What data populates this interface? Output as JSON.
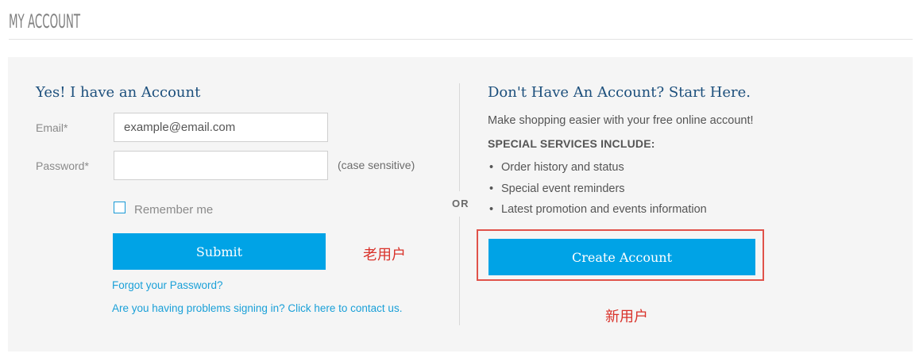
{
  "page": {
    "title": "MY ACCOUNT"
  },
  "login": {
    "heading": "Yes! I have an Account",
    "email_label": "Email*",
    "email_value": "example@email.com",
    "password_label": "Password*",
    "password_value": "",
    "case_note": "(case sensitive)",
    "remember_label": "Remember me",
    "remember_checked": false,
    "submit_label": "Submit",
    "forgot_link": "Forgot your Password?",
    "contact_link": "Are you having problems signing in? Click here to contact us."
  },
  "divider": {
    "or_label": "OR"
  },
  "signup": {
    "heading": "Don't Have An Account? Start Here.",
    "intro": "Make shopping easier with your free online account!",
    "services_heading": "SPECIAL SERVICES INCLUDE:",
    "services": [
      "Order history and status",
      "Special event reminders",
      "Latest promotion and events information"
    ],
    "create_label": "Create Account"
  },
  "annotations": {
    "existing_user": "老用户",
    "new_user": "新用户",
    "annotation_color": "#d9322a"
  },
  "colors": {
    "button": "#00a3e6",
    "heading": "#1c4f7c",
    "link": "#1aa0d8",
    "panel": "#f5f5f5"
  }
}
